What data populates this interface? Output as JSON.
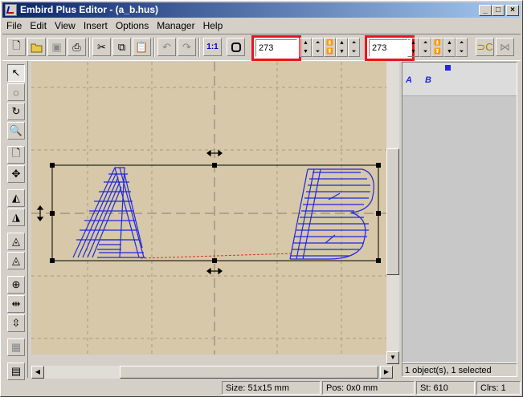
{
  "window": {
    "title": "Embird Plus Editor - (a_b.hus)"
  },
  "menu": [
    "File",
    "Edit",
    "View",
    "Insert",
    "Options",
    "Manager",
    "Help"
  ],
  "toolbar": {
    "width_value": "273",
    "height_value": "273",
    "ratio_label": "1:1"
  },
  "right_panel": {
    "status": "1 object(s), 1 selected"
  },
  "status": {
    "size": "Size: 51x15 mm",
    "pos": "Pos: 0x0 mm",
    "stitches": "St: 610",
    "colors": "Clrs: 1"
  },
  "colors": {
    "stitch": "#1f27e0",
    "canvas": "#d6c8a8",
    "highlight": "#e8161b"
  }
}
